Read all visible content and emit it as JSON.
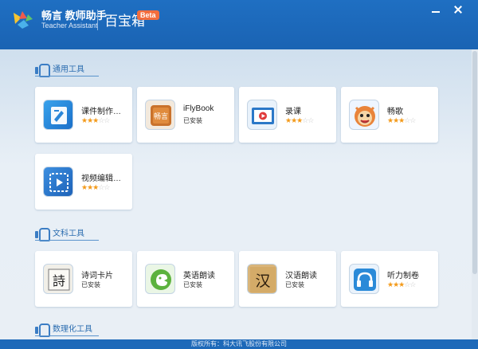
{
  "header": {
    "brand_cn": "畅言 教师助手",
    "brand_en": "Teacher Assistant",
    "app_title": "百宝箱",
    "badge": "Beta"
  },
  "sections": [
    {
      "label": "通用工具",
      "items": [
        {
          "name": "课件制作…",
          "rating": 3,
          "icon": "courseware-icon"
        },
        {
          "name": "iFlyBook",
          "status": "已安装",
          "icon": "iflybook-icon"
        },
        {
          "name": "录课",
          "rating": 3,
          "icon": "record-lesson-icon"
        },
        {
          "name": "畅歌",
          "rating": 3,
          "icon": "changge-icon"
        },
        {
          "name": "视频编辑…",
          "rating": 3,
          "icon": "video-edit-icon"
        }
      ]
    },
    {
      "label": "文科工具",
      "items": [
        {
          "name": "诗词卡片",
          "status": "已安装",
          "icon": "poem-card-icon"
        },
        {
          "name": "英语朗读",
          "status": "已安装",
          "icon": "english-read-icon"
        },
        {
          "name": "汉语朗读",
          "status": "已安装",
          "icon": "chinese-read-icon"
        },
        {
          "name": "听力制卷",
          "rating": 3,
          "icon": "listening-paper-icon"
        }
      ]
    },
    {
      "label": "数理化工具",
      "items": []
    }
  ],
  "footer": {
    "text": "版权所有：科大讯飞股份有限公司"
  },
  "colors": {
    "titlebar": "#1a63b3",
    "accent_star": "#f39a1a",
    "section_text": "#2c6db0",
    "badge": "#f26d3d"
  }
}
